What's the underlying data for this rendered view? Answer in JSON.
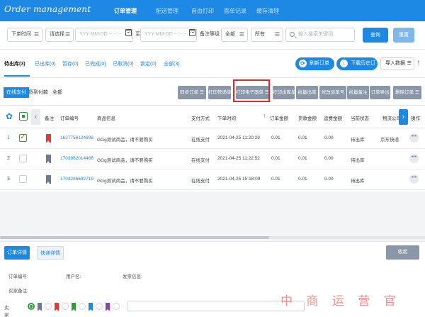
{
  "app": {
    "brand": "Order management"
  },
  "topnav": {
    "tabs": [
      {
        "label": "订单管理",
        "active": true
      },
      {
        "label": "配送管理"
      },
      {
        "label": "自由打印"
      },
      {
        "label": "面单记录"
      },
      {
        "label": "缓存清理"
      }
    ]
  },
  "filters": {
    "order_time": "下单时间",
    "select_label": "请选择",
    "date_start_placeholder": "YYY-MM-DD --:--:--",
    "range_sep": "至",
    "date_end_placeholder": "YYY-MM-DD --:--:--",
    "remark_label": "备注等级",
    "remark_value": "全部",
    "all_value": "所有",
    "search_placeholder": "输入搜索关键词",
    "query_button": "查询",
    "reset_button": "重置",
    "menu_glyph": "☰"
  },
  "status_tabs": {
    "tabs": [
      {
        "label": "待出库(3)",
        "active": true
      },
      {
        "label": "已出库(0)"
      },
      {
        "label": "暂存(0)"
      },
      {
        "label": "已完成(0)"
      },
      {
        "label": "已取消(0)"
      },
      {
        "label": "锁定(0)"
      },
      {
        "label": "全部(3)"
      }
    ],
    "refresh_button": "刷新订单",
    "download_button": "下载历史订单",
    "export_select": "导入数据",
    "menu_glyph": "☰",
    "up_arrow": "↑"
  },
  "toolbar": {
    "payment_tabs": [
      {
        "label": "在线支付",
        "active": true
      },
      {
        "label": "货到付款"
      },
      {
        "label": "全部"
      }
    ],
    "actions": [
      "同步订单 ☰",
      "打印快递单",
      "打印电子面单 ☰",
      "打印出库单",
      "批量出库",
      "修改运单号",
      "批量备注",
      "订单导出",
      "删除订单 ☰"
    ]
  },
  "table": {
    "headers": {
      "remark": "备注",
      "order_no": "订单编号",
      "product": "商品信息",
      "pay_method": "支付方式",
      "order_time": "下单时间",
      "amount": "订单金额",
      "goods_amount": "货款金额",
      "shipping": "运费金额",
      "status": "当前状态",
      "logistics": "物流公司",
      "ops": "操作"
    },
    "sort_arrow": "↑",
    "rows": [
      {
        "num": "1",
        "checked": true,
        "flag": "red",
        "order_no": "1627756124898",
        "product": "GGg测试商品，请不要购买",
        "pay": "在线支付",
        "time": "2021-04-25 11:20:29",
        "amount": "0.01",
        "goods": "0.01",
        "ship": "0.00",
        "status": "待出库",
        "logistics": "京东快递"
      },
      {
        "num": "2",
        "checked": false,
        "flag": "grey",
        "order_no": "1703962014466",
        "product": "GGg测试商品，请不要购买",
        "pay": "在线支付",
        "time": "2021-04-25 11:22:52",
        "amount": "0.01",
        "goods": "0.01",
        "ship": "0.00",
        "status": "待出库",
        "logistics": ""
      },
      {
        "num": "3",
        "checked": false,
        "flag": "grey",
        "order_no": "1704286692719",
        "product": "GGg测试商品，请不要购买",
        "pay": "在线支付",
        "time": "2021-04-25 15:18:09",
        "amount": "0.01",
        "goods": "0.01",
        "ship": "0.00",
        "status": "待出库",
        "logistics": ""
      }
    ],
    "dots": "•••"
  },
  "detail": {
    "tabs": [
      {
        "label": "订单详情",
        "active": true
      },
      {
        "label": "快递详情"
      }
    ],
    "collapse_button": "收起",
    "order_no_label": "订单编号:",
    "username_label": "用户名:",
    "invoice_label": "发票信息:",
    "buyer_memo_label": "买家备注:",
    "seller_memo_label": "卖家备注:",
    "flag_colors": [
      "#e53935",
      "#2e9d3c",
      "#1e88e5",
      "#8e44ad"
    ]
  },
  "watermark": "中 商 运 营 官",
  "colors": {
    "primary": "#1e88e5",
    "accent_green": "#2e9d3c",
    "alert_red": "#d32f2f",
    "action_grey": "#8a97a8"
  }
}
